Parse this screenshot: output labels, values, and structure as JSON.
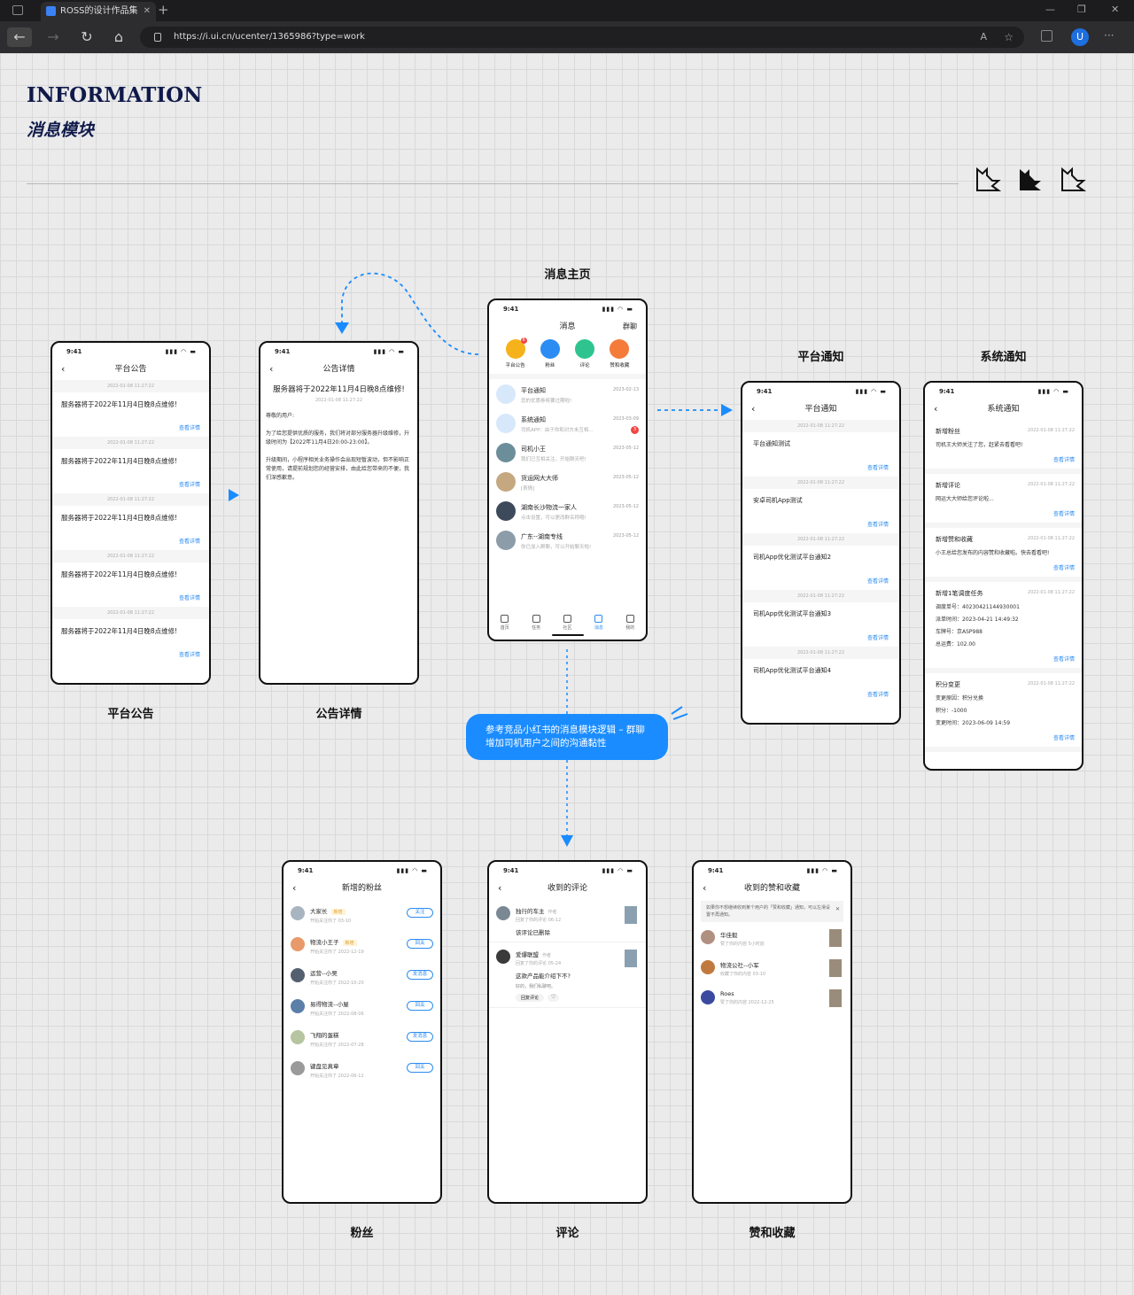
{
  "browser": {
    "tab_title": "ROSS的设计作品集",
    "tab_close": "✕",
    "new_tab": "+",
    "url": "https://i.ui.cn/ucenter/1365986?type=work",
    "reader_icon": "A",
    "fav_icon": "☆",
    "ext_label": "U",
    "menu": "···",
    "min": "—",
    "max": "❐",
    "close": "✕",
    "back": "←",
    "forward": "→",
    "reload": "↻",
    "home": "⌂"
  },
  "header": {
    "title": "INFORMATION",
    "subtitle": "消息模块"
  },
  "common": {
    "time": "9:41",
    "signal": "▮▮▮ ◠ ▬",
    "back": "‹",
    "more": "查看详情",
    "date": "2022-01-08 11:27:22"
  },
  "platform_announce": {
    "nav": "平台公告",
    "item_text": "服务器将于2022年11月4日晚8点维修!",
    "label": "平台公告"
  },
  "announce_detail": {
    "nav": "公告详情",
    "heading": "服务器将于2022年11月4日晚8点维修!",
    "greeting": "尊敬的用户:",
    "p1": "为了给您提供优质的服务，我们将对部分服务器升级维修，升级时间为【2022年11月4日20:00-23:00】。",
    "p2": "升级期间，小程序相关业务操作会出现短暂波动，但不影响正常使用，请提前规划您的经营安排，由此给您带来的不便，我们深感歉意。",
    "label": "公告详情"
  },
  "message_home": {
    "label": "消息主页",
    "nav": "消息",
    "nav_right": "群聊",
    "icons": [
      {
        "label": "平台公告",
        "badge": "8",
        "color": "#f6b21b"
      },
      {
        "label": "粉丝",
        "badge": "",
        "color": "#2b8cf3"
      },
      {
        "label": "评论",
        "badge": "",
        "color": "#2fc48f"
      },
      {
        "label": "赞和收藏",
        "badge": "",
        "color": "#f57b3b"
      }
    ],
    "conversations": [
      {
        "name": "平台通知",
        "preview": "您的优惠券将要过期啦!",
        "time": "2023-02-13",
        "badge": "",
        "color": "#d8e8fb"
      },
      {
        "name": "系统通知",
        "preview": "司机APP：由于你和对方未互相...",
        "time": "2023-03-09",
        "badge": "3",
        "color": "#d8e8fb"
      },
      {
        "name": "司机小王",
        "preview": "我们已互相关注，开始聊天吧!",
        "time": "2023-05-12",
        "badge": "",
        "color": "#6b8e9a"
      },
      {
        "name": "货运网大大师",
        "preview": "[表情]",
        "time": "2023-05-12",
        "badge": "",
        "color": "#c5a880"
      },
      {
        "name": "湖南长沙物流一家人",
        "preview": "点击设置，可以更改群名称哦!",
        "time": "2023-05-12",
        "badge": "",
        "color": "#3d4a5c"
      },
      {
        "name": "广东--湖南专线",
        "preview": "你已加入群聊，可以开始聊天啦!",
        "time": "2023-05-12",
        "badge": "",
        "color": "#8c9ca8"
      }
    ],
    "tabs": [
      "首页",
      "任务",
      "社区",
      "消息",
      "我的"
    ]
  },
  "platform_notice": {
    "label": "平台通知",
    "nav": "平台通知",
    "items": [
      "平台通知测试",
      "安卓司机App测试",
      "司机App优化测试平台通知2",
      "司机App优化测试平台通知3",
      "司机App优化测试平台通知4"
    ]
  },
  "system_notice": {
    "label": "系统通知",
    "nav": "系统通知",
    "cards": [
      {
        "title": "新增粉丝",
        "lines": [
          "司机王大师关注了您，赶紧去看看吧!"
        ]
      },
      {
        "title": "新增评论",
        "lines": [
          "网运大大师给您评论啦..."
        ]
      },
      {
        "title": "新增赞和收藏",
        "lines": [
          "小王总给您发布的内容赞和收藏啦。快去看看吧!"
        ]
      },
      {
        "title": "新增1笔调度任务",
        "lines": [
          "调度单号：40230421144930001",
          "派单时间：2023-04-21 14:49:32",
          "车牌号：京ASP988",
          "总运费：102.00"
        ]
      },
      {
        "title": "积分变更",
        "lines": [
          "变更原因：积分兑换",
          "积分：-1000",
          "变更时间：2023-06-09 14:59"
        ]
      }
    ]
  },
  "note": {
    "line1": "参考竞品小红书的消息模块逻辑 – 群聊",
    "line2": "增加司机用户之间的沟通黏性"
  },
  "fans": {
    "label": "粉丝",
    "nav": "新增的粉丝",
    "items": [
      {
        "name": "大家长",
        "tag": "新增",
        "sub": "开始关注你了 03-10",
        "btn": "关注",
        "color": "#a8b4c0"
      },
      {
        "name": "物流小王子",
        "tag": "新增",
        "sub": "开始关注你了 2022-12-19",
        "btn": "回关",
        "color": "#e89a6a"
      },
      {
        "name": "运营--小吴",
        "tag": "",
        "sub": "开始关注你了 2022-10-20",
        "btn": "发消息",
        "color": "#546070"
      },
      {
        "name": "易得物流--小屋",
        "tag": "",
        "sub": "开始关注你了 2022-08-06",
        "btn": "回关",
        "color": "#5a7fa8"
      },
      {
        "name": "飞翔的蛋糕",
        "tag": "",
        "sub": "开始关注你了 2022-07-28",
        "btn": "发消息",
        "color": "#b7c4a0"
      },
      {
        "name": "键盘见真章",
        "tag": "",
        "sub": "开始关注你了 2022-06-12",
        "btn": "回关",
        "color": "#9a9a9a"
      }
    ]
  },
  "comments": {
    "label": "评论",
    "nav": "收到的评论",
    "items": [
      {
        "name": "独行的车主",
        "role": "作者",
        "sub": "回复了你的评论 06-12",
        "body": "该评论已删除",
        "quote": "",
        "color": "#7a8894"
      },
      {
        "name": "爱爆联盟",
        "role": "作者",
        "sub": "回复了你的评论 05-24",
        "body": "这款产品能介绍下不?",
        "quote": "好的，我们私聊吧。",
        "color": "#3a3a3a"
      }
    ],
    "reply": "回复评论",
    "like": "♡"
  },
  "likes": {
    "label": "赞和收藏",
    "nav": "收到的赞和收藏",
    "banner": "如果你不想继续收到某个用户的「赞和收藏」通知，可以左滑设置不再通知。",
    "banner_close": "✕",
    "items": [
      {
        "name": "华佳毅",
        "sub": "赞了你的内容 5小时前",
        "color": "#b09080"
      },
      {
        "name": "物流公社--小军",
        "sub": "收藏了你的内容 03-10",
        "color": "#c07a40"
      },
      {
        "name": "Roes",
        "sub": "赞了你的内容 2022-12-25",
        "color": "#3a4aa0"
      }
    ]
  }
}
